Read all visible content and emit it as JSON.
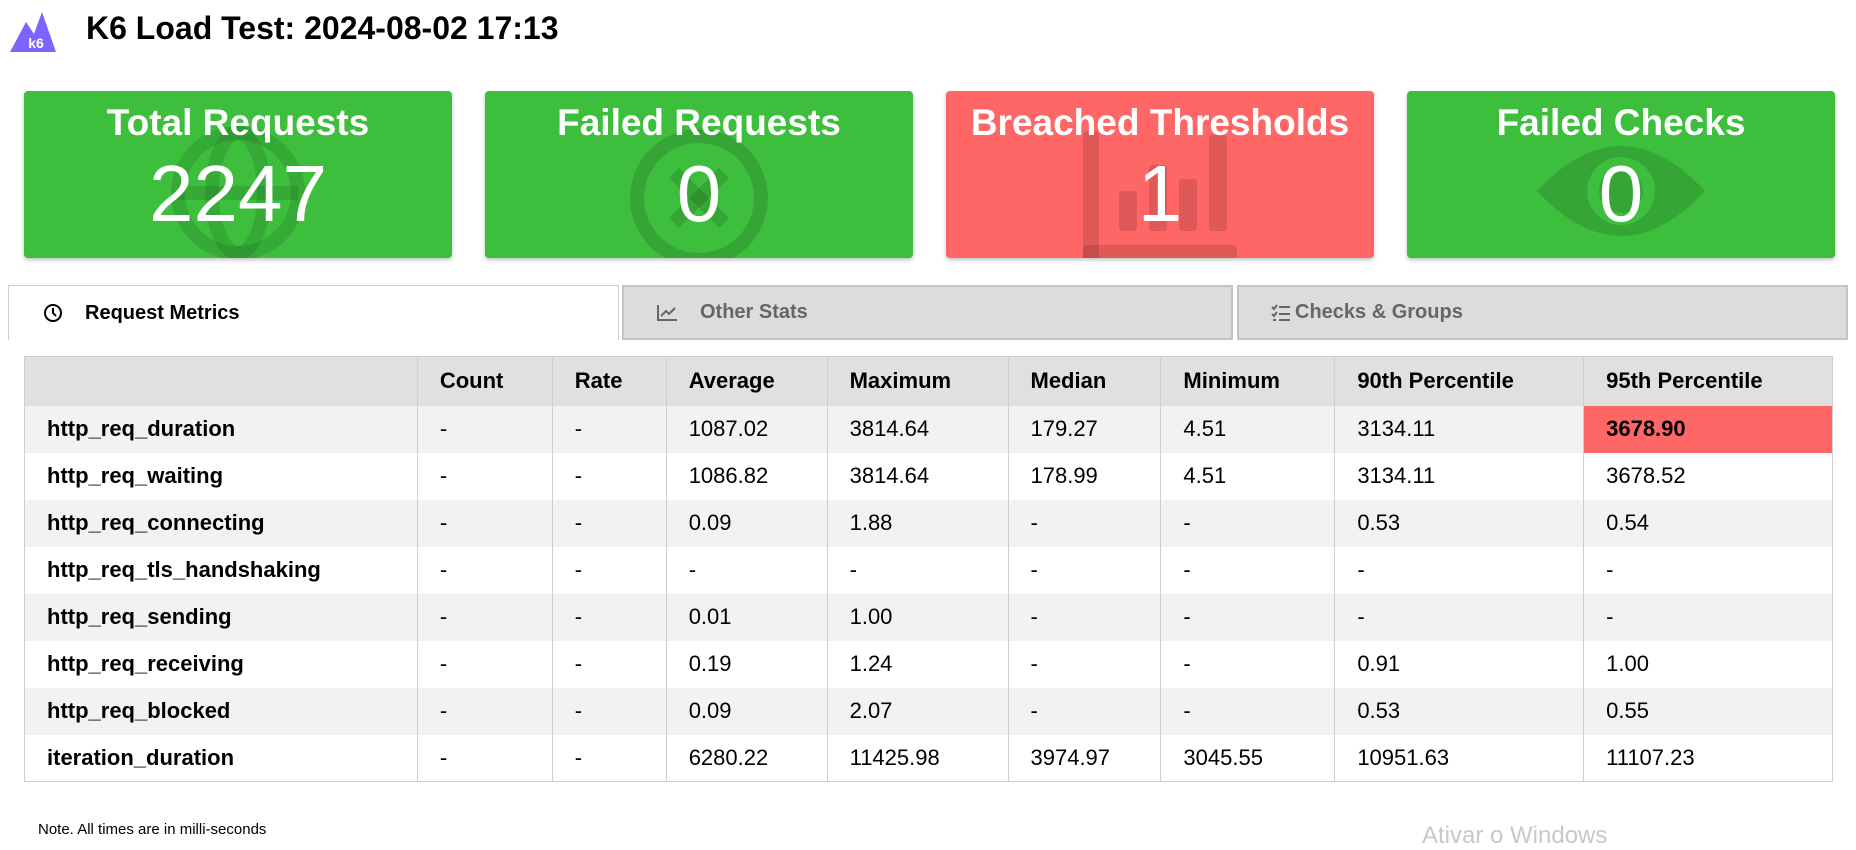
{
  "header": {
    "logo_text": "k6",
    "title": "K6 Load Test: 2024-08-02 17:13"
  },
  "colors": {
    "pass": "#3dbe3d",
    "fail": "#ff6666"
  },
  "cards": [
    {
      "title": "Total Requests",
      "value": "2247",
      "status": "pass",
      "icon": "globe-icon"
    },
    {
      "title": "Failed Requests",
      "value": "0",
      "status": "pass",
      "icon": "x-circle-icon"
    },
    {
      "title": "Breached Thresholds",
      "value": "1",
      "status": "fail",
      "icon": "bar-chart-icon"
    },
    {
      "title": "Failed Checks",
      "value": "0",
      "status": "pass",
      "icon": "eye-icon"
    }
  ],
  "tabs": [
    {
      "label": "Request Metrics",
      "icon": "clock-icon",
      "active": true
    },
    {
      "label": "Other Stats",
      "icon": "line-chart-icon",
      "active": false
    },
    {
      "label": "Checks & Groups",
      "icon": "checklist-icon",
      "active": false
    }
  ],
  "table": {
    "columns": [
      "",
      "Count",
      "Rate",
      "Average",
      "Maximum",
      "Median",
      "Minimum",
      "90th Percentile",
      "95th Percentile"
    ],
    "rows": [
      [
        "http_req_duration",
        "-",
        "-",
        "1087.02",
        "3814.64",
        "179.27",
        "4.51",
        "3134.11",
        "3678.90"
      ],
      [
        "http_req_waiting",
        "-",
        "-",
        "1086.82",
        "3814.64",
        "178.99",
        "4.51",
        "3134.11",
        "3678.52"
      ],
      [
        "http_req_connecting",
        "-",
        "-",
        "0.09",
        "1.88",
        "-",
        "-",
        "0.53",
        "0.54"
      ],
      [
        "http_req_tls_handshaking",
        "-",
        "-",
        "-",
        "-",
        "-",
        "-",
        "-",
        "-"
      ],
      [
        "http_req_sending",
        "-",
        "-",
        "0.01",
        "1.00",
        "-",
        "-",
        "-",
        "-"
      ],
      [
        "http_req_receiving",
        "-",
        "-",
        "0.19",
        "1.24",
        "-",
        "-",
        "0.91",
        "1.00"
      ],
      [
        "http_req_blocked",
        "-",
        "-",
        "0.09",
        "2.07",
        "-",
        "-",
        "0.53",
        "0.55"
      ],
      [
        "iteration_duration",
        "-",
        "-",
        "6280.22",
        "11425.98",
        "3974.97",
        "3045.55",
        "10951.63",
        "11107.23"
      ]
    ],
    "breached_cell": "http_req_duration / 95th Percentile"
  },
  "note": "Note. All times are in milli-seconds",
  "watermark": "Ativar o Windows"
}
